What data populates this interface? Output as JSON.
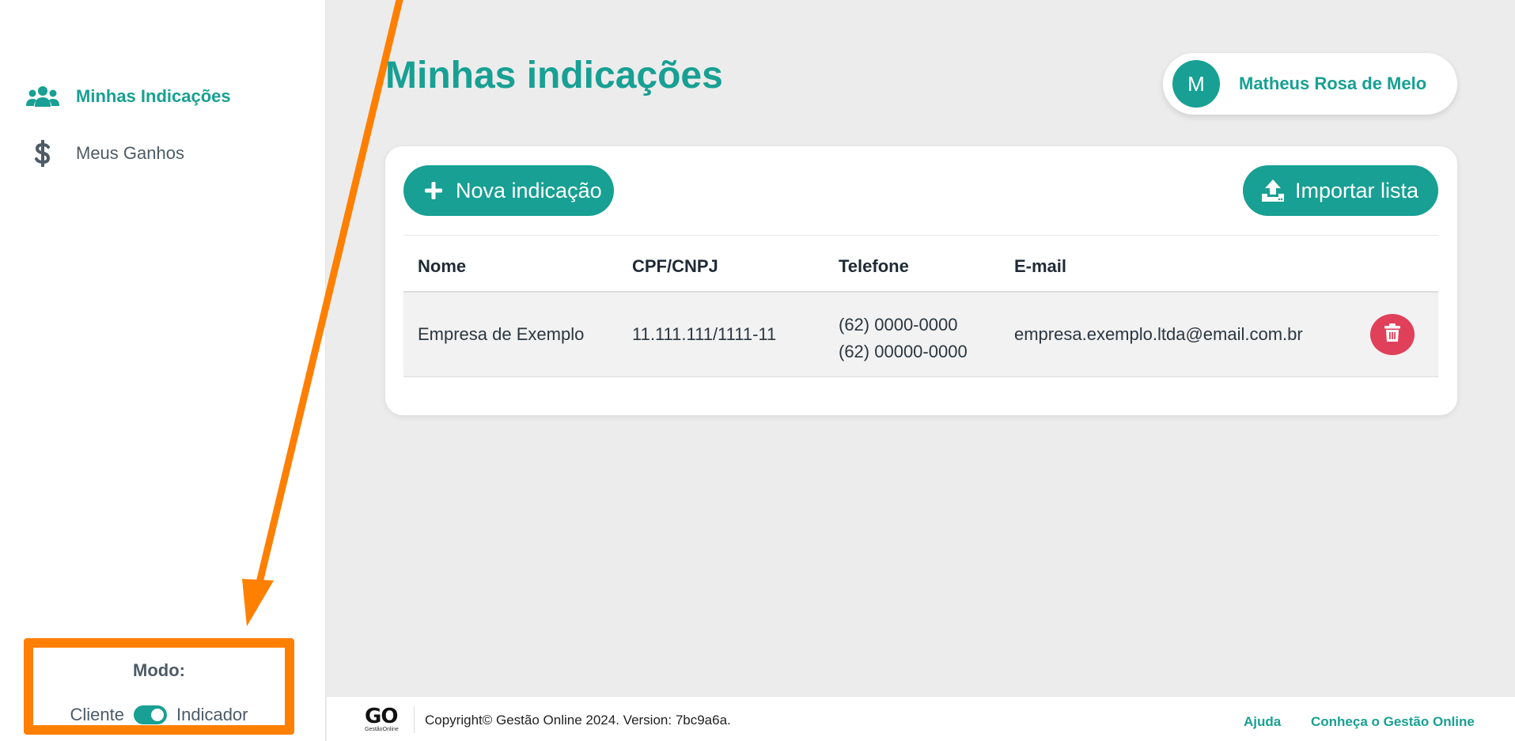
{
  "sidebar": {
    "items": [
      {
        "label": "Minhas Indicações",
        "icon": "users-icon",
        "active": true
      },
      {
        "label": "Meus Ganhos",
        "icon": "dollar-icon",
        "active": false
      }
    ],
    "mode": {
      "title": "Modo:",
      "left_label": "Cliente",
      "right_label": "Indicador",
      "state": "Indicador"
    }
  },
  "header": {
    "title": "Minhas indicações",
    "user": {
      "initial": "M",
      "name": "Matheus Rosa de Melo"
    }
  },
  "actions": {
    "new_label": "Nova indicação",
    "import_label": "Importar lista"
  },
  "table": {
    "columns": [
      "Nome",
      "CPF/CNPJ",
      "Telefone",
      "E-mail"
    ],
    "rows": [
      {
        "name": "Empresa de Exemplo",
        "doc": "11.111.111/1111-11",
        "phones": [
          "(62) 0000-0000",
          "(62) 00000-0000"
        ],
        "email": "empresa.exemplo.ltda@email.com.br"
      }
    ]
  },
  "footer": {
    "logo_text": "GO",
    "logo_sub": "GestãoOnline",
    "copyright": "Copyright© Gestão Online 2024. Version: 7bc9a6a.",
    "links": [
      "Ajuda",
      "Conheça o Gestão Online"
    ]
  },
  "colors": {
    "accent": "#17a093",
    "danger": "#e0405a",
    "annotation": "#ff7f00"
  }
}
